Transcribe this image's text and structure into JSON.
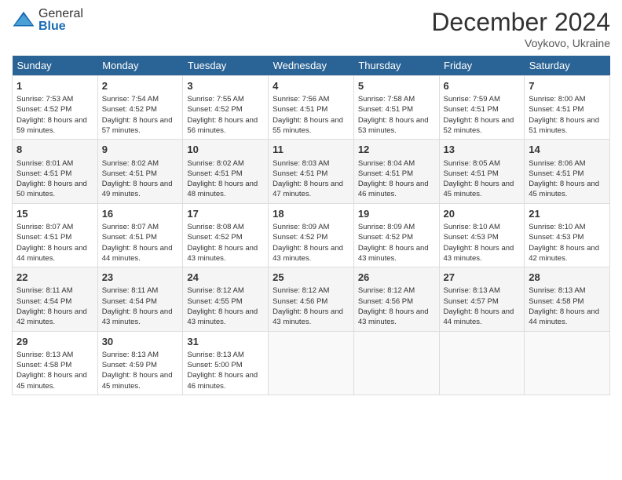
{
  "header": {
    "logo_general": "General",
    "logo_blue": "Blue",
    "title": "December 2024",
    "location": "Voykovo, Ukraine"
  },
  "days_of_week": [
    "Sunday",
    "Monday",
    "Tuesday",
    "Wednesday",
    "Thursday",
    "Friday",
    "Saturday"
  ],
  "weeks": [
    [
      {
        "day": 1,
        "sunrise": "7:53 AM",
        "sunset": "4:52 PM",
        "daylight": "8 hours and 59 minutes."
      },
      {
        "day": 2,
        "sunrise": "7:54 AM",
        "sunset": "4:52 PM",
        "daylight": "8 hours and 57 minutes."
      },
      {
        "day": 3,
        "sunrise": "7:55 AM",
        "sunset": "4:52 PM",
        "daylight": "8 hours and 56 minutes."
      },
      {
        "day": 4,
        "sunrise": "7:56 AM",
        "sunset": "4:51 PM",
        "daylight": "8 hours and 55 minutes."
      },
      {
        "day": 5,
        "sunrise": "7:58 AM",
        "sunset": "4:51 PM",
        "daylight": "8 hours and 53 minutes."
      },
      {
        "day": 6,
        "sunrise": "7:59 AM",
        "sunset": "4:51 PM",
        "daylight": "8 hours and 52 minutes."
      },
      {
        "day": 7,
        "sunrise": "8:00 AM",
        "sunset": "4:51 PM",
        "daylight": "8 hours and 51 minutes."
      }
    ],
    [
      {
        "day": 8,
        "sunrise": "8:01 AM",
        "sunset": "4:51 PM",
        "daylight": "8 hours and 50 minutes."
      },
      {
        "day": 9,
        "sunrise": "8:02 AM",
        "sunset": "4:51 PM",
        "daylight": "8 hours and 49 minutes."
      },
      {
        "day": 10,
        "sunrise": "8:02 AM",
        "sunset": "4:51 PM",
        "daylight": "8 hours and 48 minutes."
      },
      {
        "day": 11,
        "sunrise": "8:03 AM",
        "sunset": "4:51 PM",
        "daylight": "8 hours and 47 minutes."
      },
      {
        "day": 12,
        "sunrise": "8:04 AM",
        "sunset": "4:51 PM",
        "daylight": "8 hours and 46 minutes."
      },
      {
        "day": 13,
        "sunrise": "8:05 AM",
        "sunset": "4:51 PM",
        "daylight": "8 hours and 45 minutes."
      },
      {
        "day": 14,
        "sunrise": "8:06 AM",
        "sunset": "4:51 PM",
        "daylight": "8 hours and 45 minutes."
      }
    ],
    [
      {
        "day": 15,
        "sunrise": "8:07 AM",
        "sunset": "4:51 PM",
        "daylight": "8 hours and 44 minutes."
      },
      {
        "day": 16,
        "sunrise": "8:07 AM",
        "sunset": "4:51 PM",
        "daylight": "8 hours and 44 minutes."
      },
      {
        "day": 17,
        "sunrise": "8:08 AM",
        "sunset": "4:52 PM",
        "daylight": "8 hours and 43 minutes."
      },
      {
        "day": 18,
        "sunrise": "8:09 AM",
        "sunset": "4:52 PM",
        "daylight": "8 hours and 43 minutes."
      },
      {
        "day": 19,
        "sunrise": "8:09 AM",
        "sunset": "4:52 PM",
        "daylight": "8 hours and 43 minutes."
      },
      {
        "day": 20,
        "sunrise": "8:10 AM",
        "sunset": "4:53 PM",
        "daylight": "8 hours and 43 minutes."
      },
      {
        "day": 21,
        "sunrise": "8:10 AM",
        "sunset": "4:53 PM",
        "daylight": "8 hours and 42 minutes."
      }
    ],
    [
      {
        "day": 22,
        "sunrise": "8:11 AM",
        "sunset": "4:54 PM",
        "daylight": "8 hours and 42 minutes."
      },
      {
        "day": 23,
        "sunrise": "8:11 AM",
        "sunset": "4:54 PM",
        "daylight": "8 hours and 43 minutes."
      },
      {
        "day": 24,
        "sunrise": "8:12 AM",
        "sunset": "4:55 PM",
        "daylight": "8 hours and 43 minutes."
      },
      {
        "day": 25,
        "sunrise": "8:12 AM",
        "sunset": "4:56 PM",
        "daylight": "8 hours and 43 minutes."
      },
      {
        "day": 26,
        "sunrise": "8:12 AM",
        "sunset": "4:56 PM",
        "daylight": "8 hours and 43 minutes."
      },
      {
        "day": 27,
        "sunrise": "8:13 AM",
        "sunset": "4:57 PM",
        "daylight": "8 hours and 44 minutes."
      },
      {
        "day": 28,
        "sunrise": "8:13 AM",
        "sunset": "4:58 PM",
        "daylight": "8 hours and 44 minutes."
      }
    ],
    [
      {
        "day": 29,
        "sunrise": "8:13 AM",
        "sunset": "4:58 PM",
        "daylight": "8 hours and 45 minutes."
      },
      {
        "day": 30,
        "sunrise": "8:13 AM",
        "sunset": "4:59 PM",
        "daylight": "8 hours and 45 minutes."
      },
      {
        "day": 31,
        "sunrise": "8:13 AM",
        "sunset": "5:00 PM",
        "daylight": "8 hours and 46 minutes."
      },
      null,
      null,
      null,
      null
    ]
  ]
}
